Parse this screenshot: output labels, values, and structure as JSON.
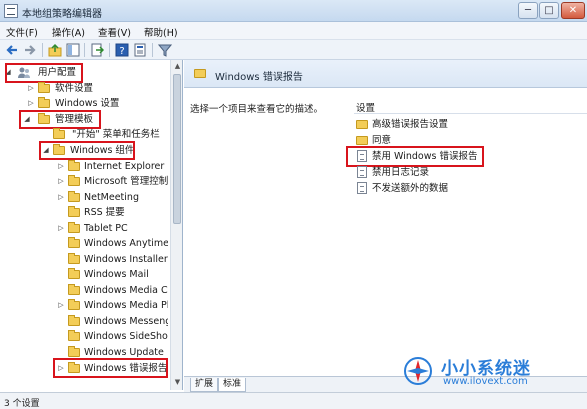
{
  "window": {
    "title": "本地组策略编辑器",
    "minimize_glyph": "─",
    "maximize_glyph": "□",
    "close_glyph": "✕"
  },
  "menu": [
    "文件(F)",
    "操作(A)",
    "查看(V)",
    "帮助(H)"
  ],
  "toolbar": {
    "buttons": [
      "back-icon",
      "forward-icon",
      "up-folder-icon",
      "show-hide-tree-icon",
      "export-list-icon",
      "help-icon",
      "properties-icon",
      "filter-icon"
    ]
  },
  "tree": {
    "items": [
      {
        "label": "用户配置",
        "arrow": "◢",
        "highlighted": true
      },
      {
        "label": "软件设置",
        "arrow": "▷"
      },
      {
        "label": "Windows 设置",
        "arrow": "▷"
      },
      {
        "label": "管理模板",
        "arrow": "◢",
        "highlighted": true
      },
      {
        "label": "\"开始\" 菜单和任务栏",
        "arrow": ""
      },
      {
        "label": "Windows 组件",
        "arrow": "◢",
        "highlighted": true
      },
      {
        "label": "Internet Explorer",
        "arrow": "▷"
      },
      {
        "label": "Microsoft 管理控制台",
        "arrow": "▷"
      },
      {
        "label": "NetMeeting",
        "arrow": "▷"
      },
      {
        "label": "RSS 提要",
        "arrow": ""
      },
      {
        "label": "Tablet PC",
        "arrow": "▷"
      },
      {
        "label": "Windows Anytime Upgrade",
        "arrow": ""
      },
      {
        "label": "Windows Installer",
        "arrow": ""
      },
      {
        "label": "Windows Mail",
        "arrow": ""
      },
      {
        "label": "Windows Media Center",
        "arrow": ""
      },
      {
        "label": "Windows Media Player",
        "arrow": "▷"
      },
      {
        "label": "Windows Messenger",
        "arrow": ""
      },
      {
        "label": "Windows SideShow",
        "arrow": ""
      },
      {
        "label": "Windows Update",
        "arrow": ""
      },
      {
        "label": "Windows 错误报告",
        "arrow": "▷",
        "highlighted": true
      }
    ]
  },
  "scroll": {
    "up": "▲",
    "down": "▼"
  },
  "right_pane": {
    "header_title": "Windows 错误报告",
    "description": "选择一个项目来查看它的描述。",
    "column_header": "设置",
    "items": [
      {
        "type": "folder",
        "label": "高级错误报告设置"
      },
      {
        "type": "folder",
        "label": "同意"
      },
      {
        "type": "setting",
        "label": "禁用 Windows 错误报告",
        "highlighted": true
      },
      {
        "type": "setting",
        "label": "禁用日志记录"
      },
      {
        "type": "setting",
        "label": "不发送额外的数据"
      }
    ]
  },
  "tabs": [
    {
      "label": "扩展",
      "active": false
    },
    {
      "label": "标准",
      "active": true
    }
  ],
  "status": "3 个设置",
  "watermark": {
    "brand": "小小系统迷",
    "url": "www.ilovext.com"
  },
  "colors": {
    "highlight_border": "#d8141c",
    "watermark": "#2a7dd8",
    "folder": "#f3cd58"
  }
}
